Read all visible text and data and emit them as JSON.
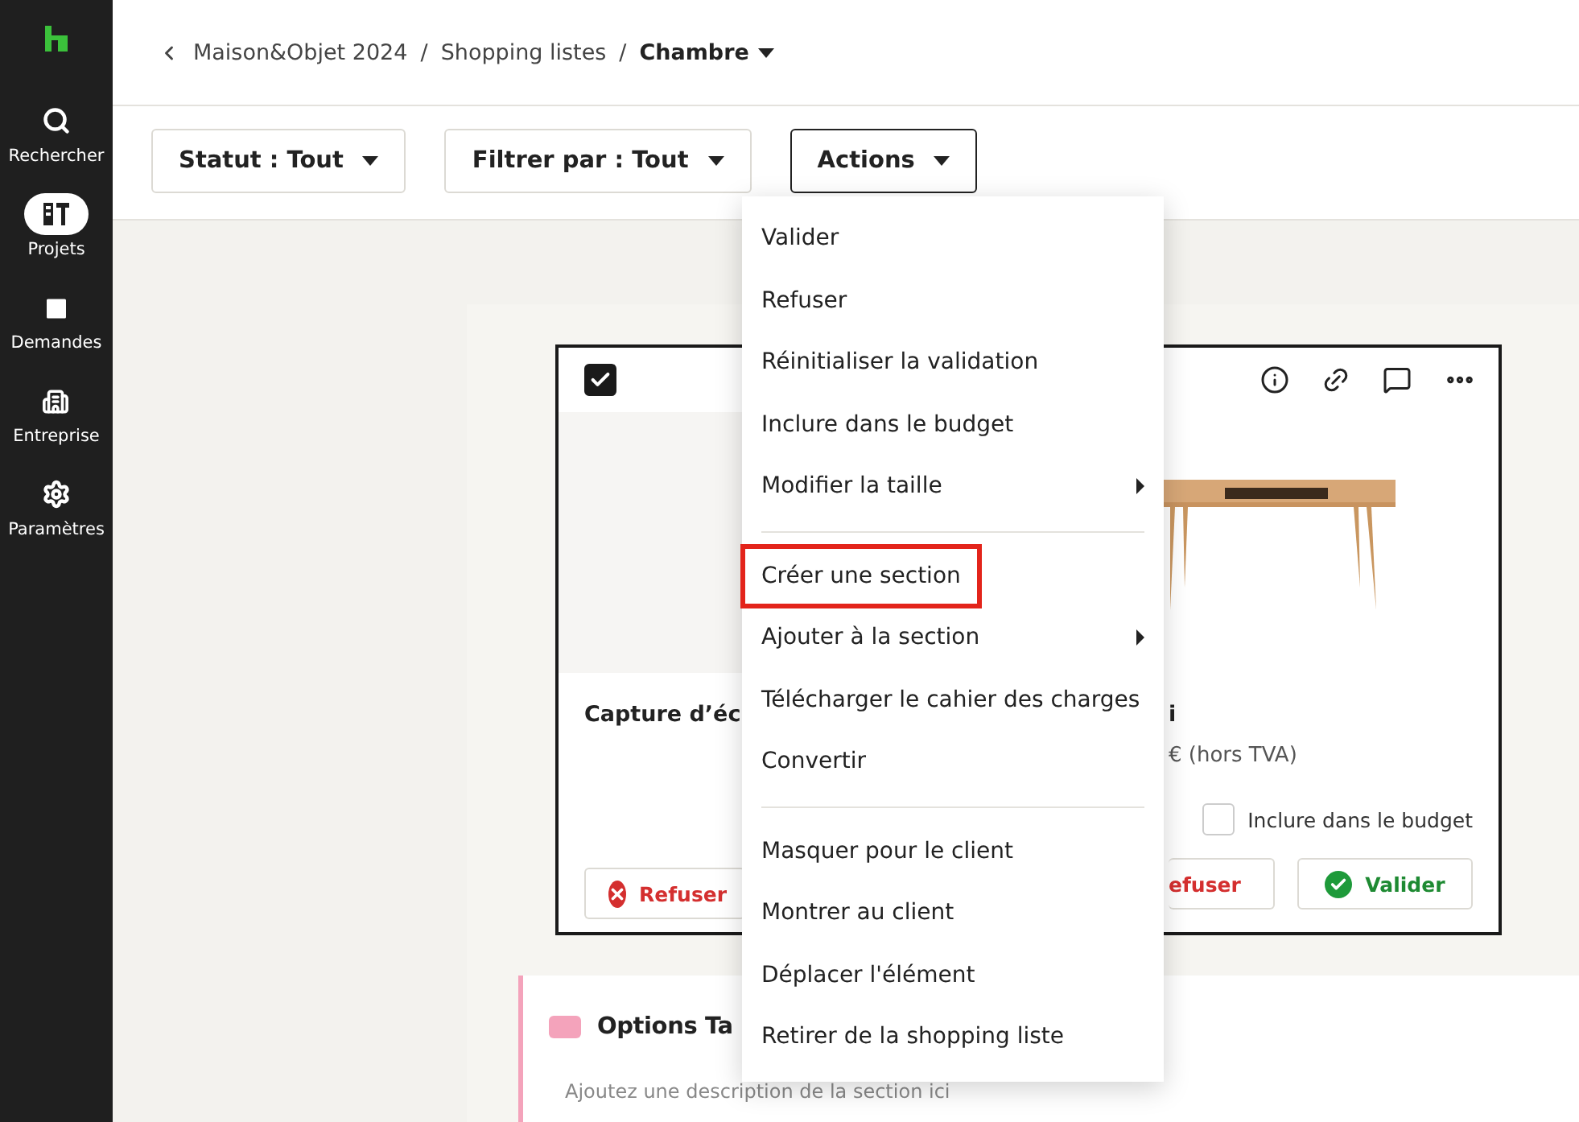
{
  "nav": [
    {
      "label": "Rechercher",
      "selected": false
    },
    {
      "label": "Projets",
      "selected": true
    },
    {
      "label": "Demandes",
      "selected": false
    },
    {
      "label": "Entreprise",
      "selected": false
    },
    {
      "label": "Paramètres",
      "selected": false
    }
  ],
  "breadcrumb": {
    "items": [
      "Maison&Objet 2024",
      "Shopping listes"
    ],
    "separators": [
      "/",
      "/"
    ],
    "current": "Chambre"
  },
  "filters": [
    {
      "label": "Statut : Tout",
      "open": false
    },
    {
      "label": "Filtrer par : Tout",
      "open": false
    },
    {
      "label": "Actions",
      "open": true
    }
  ],
  "menu": [
    {
      "kind": "item",
      "label": "Valider",
      "submenu": false,
      "highlighted": false
    },
    {
      "kind": "item",
      "label": "Refuser",
      "submenu": false,
      "highlighted": false
    },
    {
      "kind": "item",
      "label": "Réinitialiser la validation",
      "submenu": false,
      "highlighted": false
    },
    {
      "kind": "item",
      "label": "Inclure dans le budget",
      "submenu": false,
      "highlighted": false
    },
    {
      "kind": "item",
      "label": "Modifier la taille",
      "submenu": true,
      "highlighted": false
    },
    {
      "kind": "divider"
    },
    {
      "kind": "item",
      "label": "Créer une section",
      "submenu": false,
      "highlighted": true
    },
    {
      "kind": "item",
      "label": "Ajouter à la section",
      "submenu": true,
      "highlighted": false
    },
    {
      "kind": "item",
      "label": "Télécharger le cahier des charges",
      "submenu": false,
      "highlighted": false
    },
    {
      "kind": "item",
      "label": "Convertir",
      "submenu": false,
      "highlighted": false
    },
    {
      "kind": "divider"
    },
    {
      "kind": "item",
      "label": "Masquer pour le client",
      "submenu": false,
      "highlighted": false
    },
    {
      "kind": "item",
      "label": "Montrer au client",
      "submenu": false,
      "highlighted": false
    },
    {
      "kind": "item",
      "label": "Déplacer l'élément",
      "submenu": false,
      "highlighted": false
    },
    {
      "kind": "item",
      "label": "Retirer de la shopping liste",
      "submenu": false,
      "highlighted": false
    }
  ],
  "card": {
    "checked": true,
    "title_left": "Capture d’éc",
    "title_right": "i",
    "price": "€ (hors TVA)",
    "budget": {
      "label": "Inclure dans le budget",
      "checked": false
    },
    "buttons": [
      {
        "kind": "refuse",
        "label": "Refuser"
      },
      {
        "kind": "refuse",
        "label": "efuser"
      },
      {
        "kind": "validate",
        "label": "Valider"
      }
    ]
  },
  "section": {
    "title": "Options Ta",
    "color": "#f4a3bb",
    "description": "Ajoutez une description de la section ici"
  }
}
